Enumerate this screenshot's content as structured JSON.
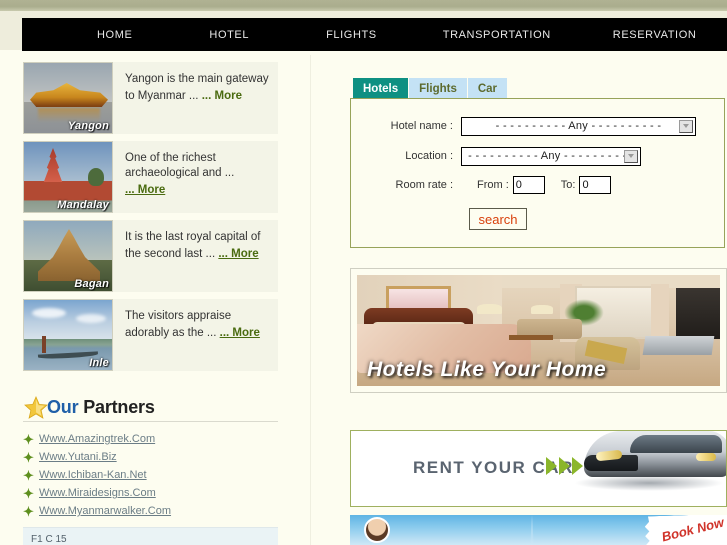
{
  "nav": {
    "items": [
      {
        "id": "home",
        "label": "HOME"
      },
      {
        "id": "hotel",
        "label": "HOTEL"
      },
      {
        "id": "flights",
        "label": "FLIGHTS"
      },
      {
        "id": "transportation",
        "label": "TRANSPORTATION"
      },
      {
        "id": "reservation",
        "label": "RESERVATION"
      }
    ]
  },
  "destinations": [
    {
      "name": "Yangon",
      "text": "Yangon is the main gateway to Myanmar ...",
      "more": "... More"
    },
    {
      "name": "Mandalay",
      "text": "One of the richest archaeological and ...",
      "more": "... More "
    },
    {
      "name": "Bagan",
      "text": "It is the last royal capital of the second last ...",
      "more": "... More "
    },
    {
      "name": "Inle",
      "text": "The visitors appraise adorably as the ...",
      "more": "... More "
    }
  ],
  "partners": {
    "title_part1": "Our",
    "title_part2": " Partners",
    "bullet": "✦",
    "links": [
      "Www.Amazingtrek.Com",
      "Www.Yutani.Biz",
      "Www.Ichiban-Kan.Net",
      "Www.Miraidesigns.Com",
      "Www.Myanmarwalker.Com"
    ]
  },
  "bottom_left_box": {
    "text": "F1 C  15"
  },
  "search_panel": {
    "tabs": [
      {
        "id": "hotels",
        "label": "Hotels",
        "active": true
      },
      {
        "id": "flights",
        "label": "Flights",
        "active": false
      },
      {
        "id": "car",
        "label": "Car",
        "active": false
      }
    ],
    "hotel_name_label": "Hotel name :",
    "hotel_name_value": "- - - - - - - - - - Any - - - - - - - - - -",
    "location_label": "Location :",
    "location_value": "- - - - - - - - - - Any - - - - - - - - - -",
    "room_rate_label": "Room rate :",
    "from_label": "From :",
    "from_value": "0",
    "to_label": "To:",
    "to_value": "0",
    "search_button_label": "search"
  },
  "banners": {
    "hotel": {
      "caption": "Hotels Like Your Home"
    },
    "car": {
      "caption": "RENT YOUR CAR"
    },
    "blue": {
      "ribbon": "Book Now"
    }
  },
  "colors": {
    "top_strip": "#b0b293",
    "nav_bg": "#000000",
    "page_bg": "#fdfdf0",
    "card_bg": "#f3f4e7",
    "more_link": "#4a6b10",
    "tab_active_bg": "#0e9082",
    "tab_inactive_bg": "#c4e2f5",
    "panel_border": "#97a35a",
    "search_text": "#d8400c",
    "partner_link": "#6b7d86",
    "bullet_green": "#5e8f1e",
    "title_blue": "#1f5fa8",
    "chevron_green": "#8bb62b",
    "ribbon_red": "#d0332a"
  }
}
